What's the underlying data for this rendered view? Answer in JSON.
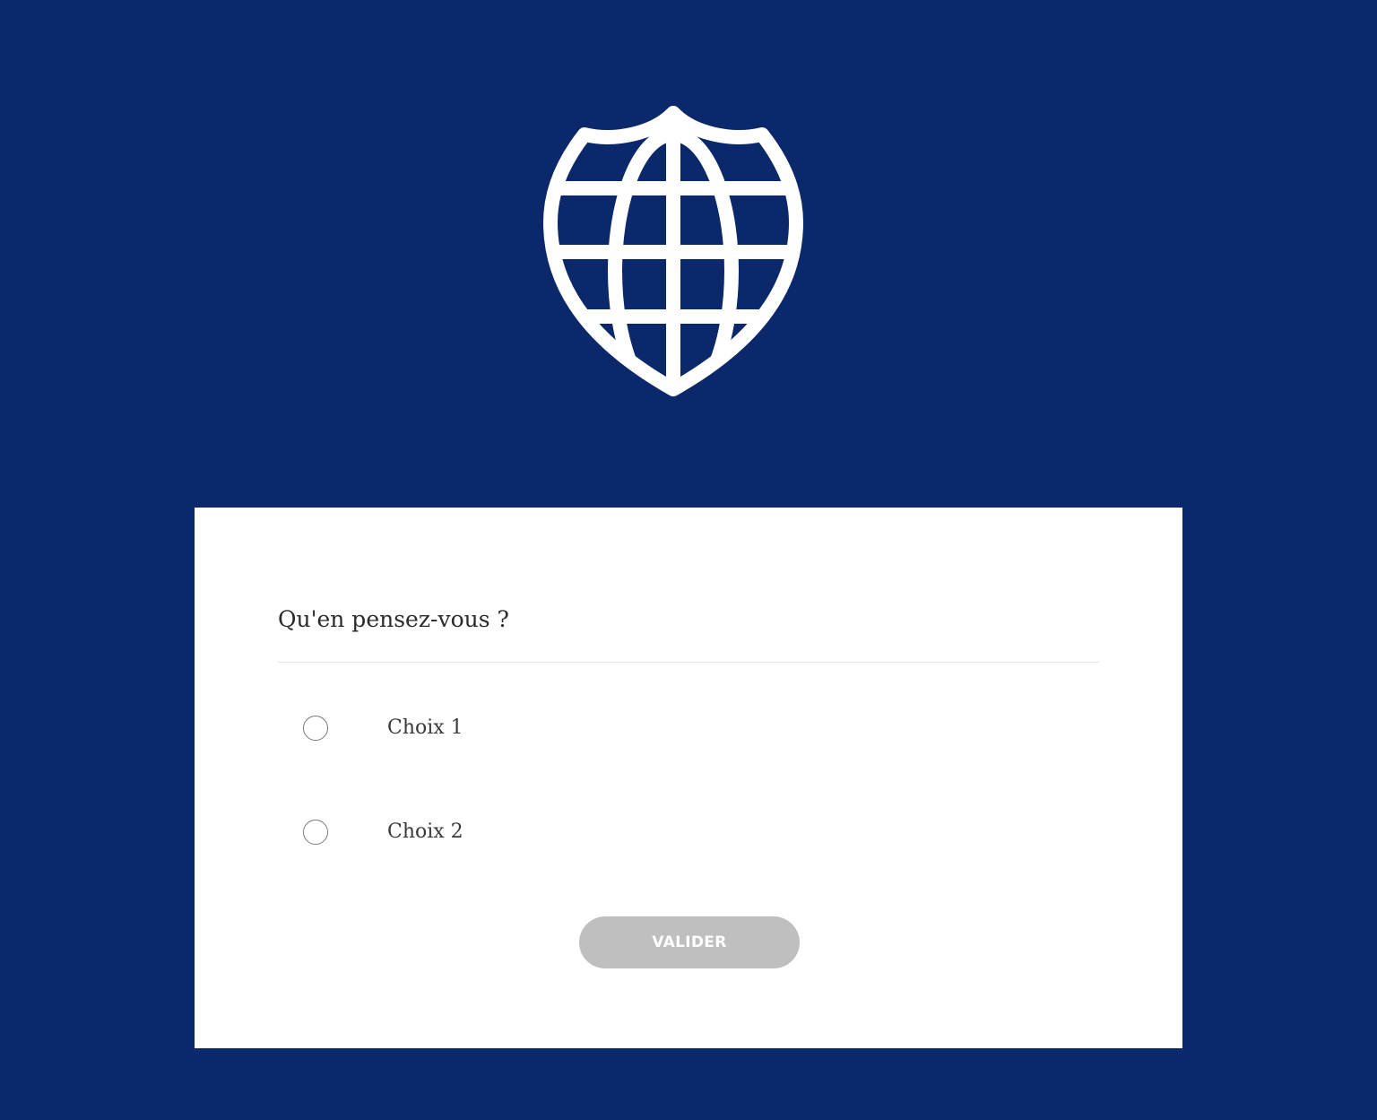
{
  "colors": {
    "background": "#0a286a",
    "card": "#ffffff",
    "logo": "#ffffff",
    "button_disabled": "#bfbfbf",
    "button_text": "#ffffff"
  },
  "logo": {
    "icon": "globe-shield-icon"
  },
  "form": {
    "question": "Qu'en pensez-vous ?",
    "options": [
      {
        "label": "Choix 1",
        "selected": false
      },
      {
        "label": "Choix 2",
        "selected": false
      }
    ],
    "submit_label": "VALIDER",
    "submit_enabled": false
  }
}
